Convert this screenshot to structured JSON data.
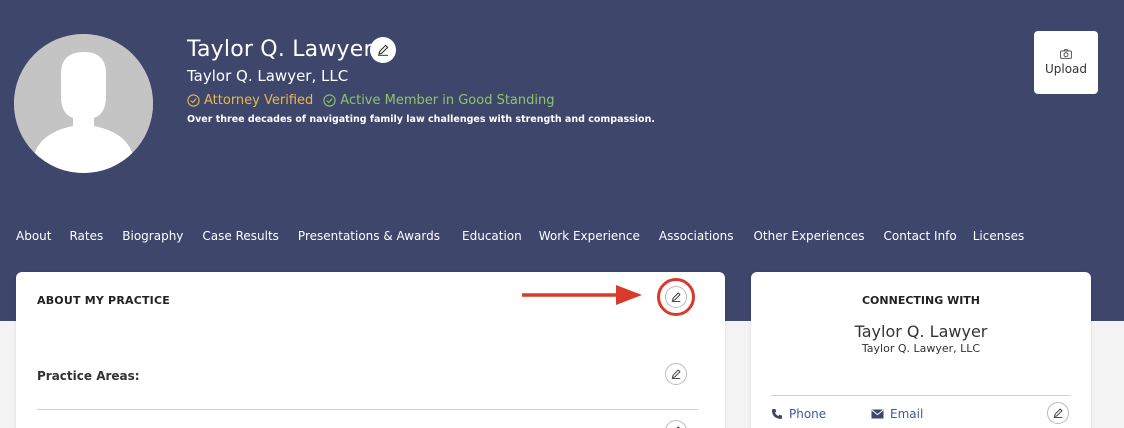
{
  "profile": {
    "name": "Taylor Q. Lawyer",
    "firm": "Taylor Q. Lawyer, LLC",
    "verified_label": "Attorney Verified",
    "active_label": "Active Member in Good Standing",
    "tagline": "Over three decades of navigating family law challenges with strength and compassion.",
    "upload_label": "Upload"
  },
  "nav": {
    "items": [
      "About",
      "Rates",
      "Biography",
      "Case Results",
      "Presentations & Awards",
      "Education",
      "Work Experience",
      "Associations",
      "Other Experiences",
      "Contact Info",
      "Licenses"
    ]
  },
  "practice": {
    "title": "ABOUT MY PRACTICE",
    "practice_areas_label": "Practice Areas:"
  },
  "connecting": {
    "title": "CONNECTING WITH",
    "name": "Taylor Q. Lawyer",
    "firm": "Taylor Q. Lawyer, LLC",
    "phone_label": "Phone",
    "email_label": "Email"
  },
  "colors": {
    "hero_bg": "#3e466c",
    "verified": "#e8b84a",
    "active": "#8fc46a",
    "link": "#3e5a9b",
    "annotation": "#d93a2b"
  },
  "icons": {
    "edit": "pencil-icon",
    "upload": "camera-icon",
    "verified": "check-circle-icon",
    "phone": "phone-icon",
    "email": "envelope-icon"
  }
}
